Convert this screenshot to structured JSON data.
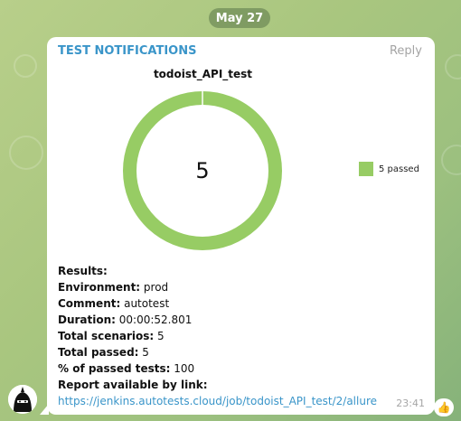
{
  "date_pill": "May 27",
  "message": {
    "sender": "TEST NOTIFICATIONS",
    "reply_label": "Reply",
    "time": "23:41"
  },
  "chart_data": {
    "type": "pie",
    "title": "todoist_API_test",
    "center_label": "5",
    "slices": [
      {
        "label": "passed",
        "value": 5,
        "color": "#97cc64"
      }
    ],
    "legend": [
      {
        "label": "5 passed",
        "color": "#97cc64"
      }
    ],
    "legend_position": "right"
  },
  "results": {
    "heading": "Results:",
    "environment_key": "Environment:",
    "environment_val": " prod",
    "comment_key": "Comment:",
    "comment_val": " autotest",
    "duration_key": "Duration:",
    "duration_val": " 00:00:52.801",
    "total_scenarios_key": "Total scenarios:",
    "total_scenarios_val": " 5",
    "total_passed_key": "Total passed:",
    "total_passed_val": " 5",
    "percent_key": "% of passed tests:",
    "percent_val": " 100",
    "report_key": "Report available by link:",
    "report_link": "https://jenkins.autotests.cloud/job/todoist_API_test/2/allure"
  },
  "reaction_icon": "thumbs-up-icon",
  "reaction_emoji": "👍",
  "avatar_icon": "bot-avatar-icon"
}
